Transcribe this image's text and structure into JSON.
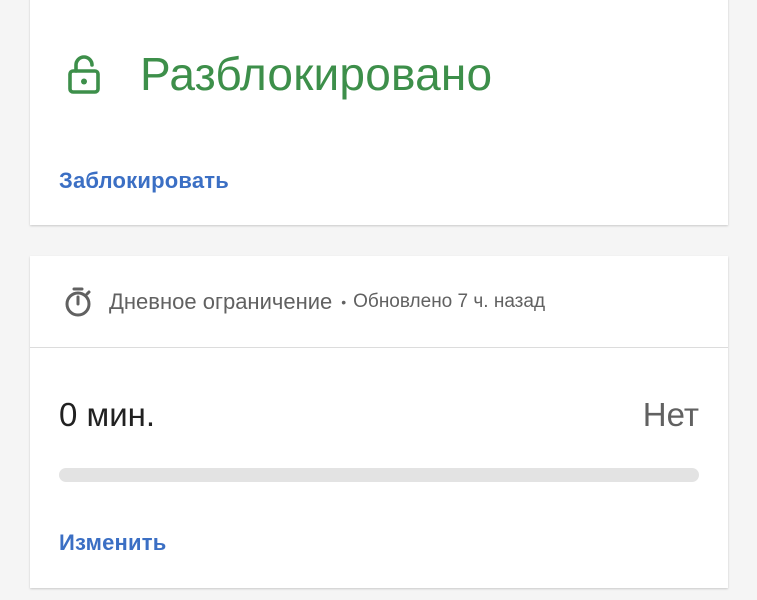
{
  "lock_card": {
    "status": "Разблокировано",
    "status_color": "#3d8f4a",
    "icon": "lock-open-icon",
    "action_label": "Заблокировать"
  },
  "limit_card": {
    "icon": "timer-icon",
    "title": "Дневное ограничение",
    "separator": "•",
    "updated": "Обновлено 7 ч. назад",
    "usage": "0 мин.",
    "limit": "Нет",
    "progress_fraction": 0,
    "action_label": "Изменить"
  },
  "colors": {
    "link": "#3b6fc4",
    "track": "#e3e3e3"
  }
}
